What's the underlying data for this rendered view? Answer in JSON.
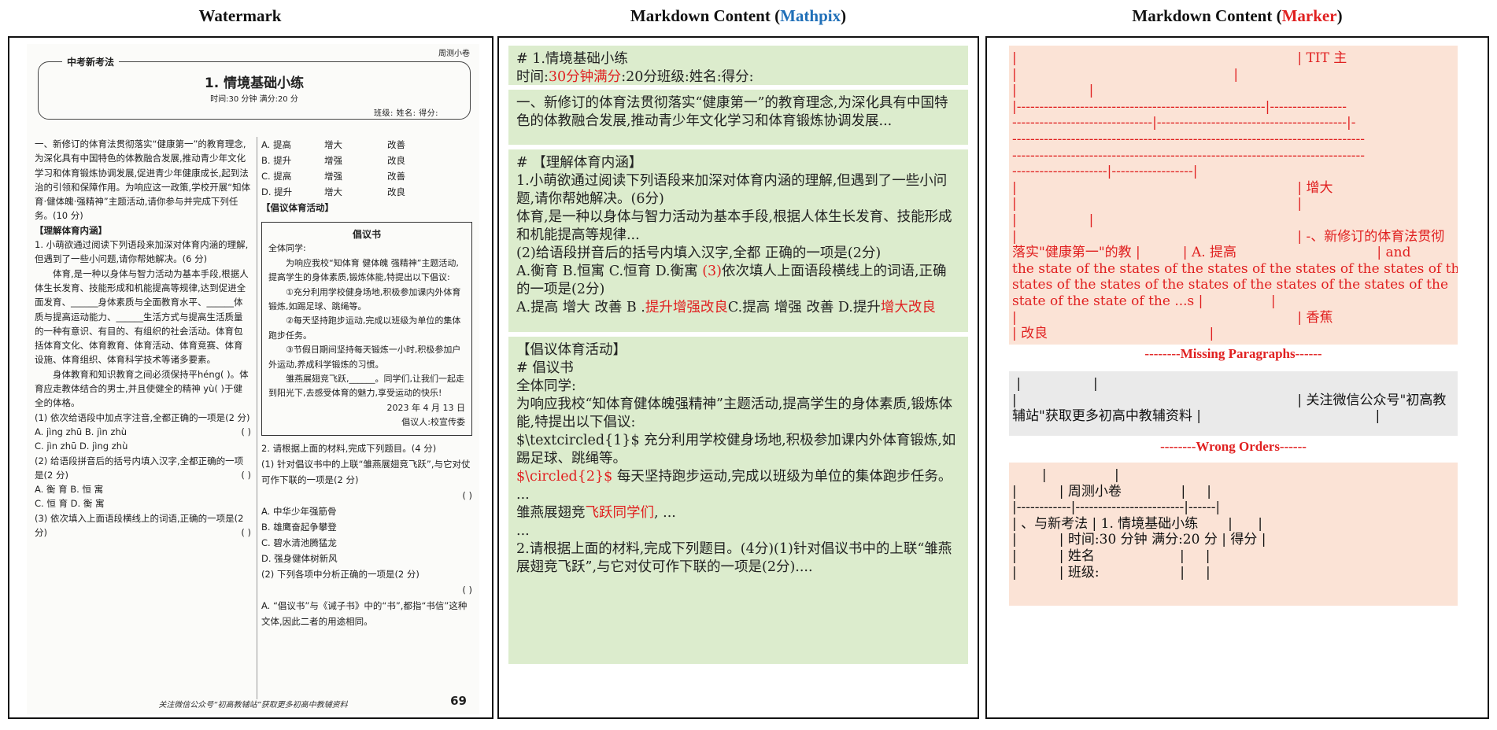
{
  "titles": {
    "left": "Watermark",
    "mid_prefix": "Markdown Content (",
    "mid_tool": "Mathpix",
    "mid_suffix": ")",
    "right_prefix": "Markdown Content (",
    "right_tool": "Marker",
    "right_suffix": ")"
  },
  "scan": {
    "page_tag": "周测小卷",
    "header_tag": "中考新考法",
    "title": "1. 情境基础小练",
    "meta": "时间:30 分钟   满分:20 分",
    "names": "班级:          姓名:          得分:",
    "left_paragraphs": [
      "一、新修订的体育法贯彻落实“健康第一”的教育理念,为深化具有中国特色的体教融合发展,推动青少年文化学习和体育锻炼协调发展,促进青少年健康成长,起到法治的引领和保障作用。为响应这一政策,学校开展“知体育·健体魄·强精神”主题活动,请你参与并完成下列任务。(10 分)",
      "【理解体育内涵】",
      "1. 小萌欲通过阅读下列语段来加深对体育内涵的理解,但遇到了一些小问题,请你帮她解决。(6 分)",
      "体育,是一种以身体与智力活动为基本手段,根据人体生长发育、技能形成和机能提高等规律,达到促进全面发育、______身体素质与全面教育水平、______体质与提高运动能力、______生活方式与提高生活质量的一种有意识、有目的、有组织的社会活动。体育包括体育文化、体育教育、体育活动、体育竞赛、体育设施、体育组织、体育科学技术等诸多要素。",
      "身体教育和知识教育之间必须保持平héng(   )。体育应走教体结合的男士,并且使健全的精神 yù(   )于健全的体格。",
      "(1) 依次给语段中加点字注音,全都正确的一项是(2 分)",
      "A. jìng   zhū     B. jìn   zhù",
      "C. jìn   zhū     D. jìng   zhù",
      "(2) 给语段拼音后的括号内填入汉字,全都正确的一项是(2 分)",
      "A. 衡   育        B. 恒   寓",
      "C. 恒   育        D. 衡   寓",
      "(3) 依次填入上面语段横线上的词语,正确的一项是(2 分)"
    ],
    "options": [
      [
        "A. 提高",
        "增大",
        "改善"
      ],
      [
        "B. 提升",
        "增强",
        "改良"
      ],
      [
        "C. 提高",
        "增强",
        "改善"
      ],
      [
        "D. 提升",
        "增大",
        "改良"
      ]
    ],
    "activity_label": "【倡议体育活动】",
    "box_title": "倡议书",
    "box_lines": [
      "全体同学:",
      "为响应我校“知体育 健体魄 强精神”主题活动,提高学生的身体素质,锻炼体能,特提出以下倡议:",
      "①充分利用学校健身场地,积极参加课内外体育锻炼,如踢足球、跳绳等。",
      "②每天坚持跑步运动,完成以班级为单位的集体跑步任务。",
      "③节假日期间坚持每天锻炼一小时,积极参加户外运动,养成科学锻炼的习惯。",
      "雏燕展翅竞飞跃,______。同学们,让我们一起走到阳光下,去感受体育的魅力,享受运动的快乐!"
    ],
    "box_date": "2023 年 4 月 13 日",
    "box_sign": "倡议人:校宣传委",
    "q2": "2. 请根据上面的材料,完成下列题目。(4 分)",
    "q2_1": "(1) 针对倡议书中的上联“雏燕展翅竞飞跃”,与它对仗可作下联的一项是(2 分)",
    "q2_opts": [
      "A. 中华少年强筋骨",
      "B. 雄鹰奋起争攀登",
      "C. 碧水清池腾猛龙",
      "D. 强身健体树新风"
    ],
    "q2_2": "(2) 下列各项中分析正确的一项是(2 分)",
    "q2_2a": "A. “倡议书”与《诫子书》中的“书”,都指“书信”这种文体,因此二者的用途相同。",
    "answer_paren": "(      )",
    "footer": "关注微信公众号“初高教辅站”获取更多初高中教辅资料",
    "page_no": "69"
  },
  "mathpix": {
    "b1_l1": "# 1.情境基础小练",
    "b1_l2a": "时间:",
    "b1_l2b": "30分钟满分",
    "b1_l2c": ":20分班级:姓名:得分:",
    "b2": "一、新修订的体育法贯彻落实“健康第一”的教育理念,为深化具有中国特色的体教融合发展,推动青少年文化学习和体育锻炼协调发展...",
    "b3_l1": "# 【理解体育内涵】",
    "b3_l2": "1.小萌欲通过阅读下列语段来加深对体育内涵的理解,但遇到了一些小问题,请你帮她解决。(6分)",
    "b3_l3": "体育,是一种以身体与智力活动为基本手段,根据人体生长发育、技能形成和机能提高等规律...",
    "b3_l4": "(2)给语段拼音后的括号内填入汉字,全都 正确的一项是(2分)",
    "b3_l5a": "A.衡育 B.恒寓 C.恒育 D.衡寓 ",
    "b3_l5b": "(3)",
    "b3_l5c": "依次填人上面语段横线上的词语,正确的一项是(2分)",
    "b3_l6a": "A.提高 增大 改善 B .",
    "b3_l6b": "提升增强改良",
    "b3_l6c": "C.提高 增强 改善 D.提升",
    "b3_l6d": "增大改良",
    "b4_l1": "【倡议体育活动】",
    "b4_l2": "# 倡议书",
    "b4_l3": "全体同学:",
    "b4_l4": "为响应我校“知体育健体魄强精神”主题活动,提高学生的身体素质,锻炼体能,特提出以下倡议:",
    "b4_l5": "$\\textcircled{1}$ 充分利用学校健身场地,积极参加课内外体育锻炼,如踢足球、跳绳等。",
    "b4_l6a": "$\\circled{2}$",
    "b4_l6b": " 每天坚持跑步运动,完成以班级为单位的集体跑步任务。",
    "b4_l7": "...",
    "b4_l8a": "雏燕展翅竞",
    "b4_l8b": "飞跃同学们",
    "b4_l8c": ", ...",
    "b4_l9": "...",
    "b4_l10": "2.请根据上面的材料,完成下列题目。(4分)(1)针对倡议书中的上联“雏燕展翅竞飞跃”,与它对仗可作下联的一项是(2分)...."
  },
  "marker": {
    "pink1": [
      "|                                                                  | TIT 主",
      "|                                                   |",
      "|                 |",
      "|-------------------------------------------------------|-----------------",
      "-------------------------------|------------------------------------------|-",
      "------------------------------------------------------------------------------",
      "------------------------------------------------------------------------------",
      "---------------------|------------------|",
      "|                                                                  | 增大",
      "|                                                                  |",
      "|                 |",
      "|                                                                  | -、新修订的体育法贯彻",
      "落实\"健康第一\"的教 |          | A. 提高                                 | and",
      "the state of the states of the states of the states of the states of the",
      "states of the states of the states of the states of the states of the",
      "state of the state of the ...s |                |",
      "|                                                                  | 香蕉",
      "| 改良                                      |"
    ],
    "missing_label": "--------Missing Paragraphs------",
    "gray": [
      " |                 |",
      "|                                                                  | 关注微信公众号\"初高教",
      "辅站\"获取更多初高中教辅资料 |                                         |"
    ],
    "wrong_label": "--------Wrong Orders------",
    "pink2": [
      "       |                |",
      "",
      "|          | 周测小卷              |     |",
      "|------------|------------------------|------|",
      "| 、与新考法 | 1. 情境基础小练       |      |",
      "|          | 时间:30 分钟 满分:20 分 | 得分 |",
      "|          | 姓名                    |     |",
      "|          | 班级:                   |     |"
    ]
  }
}
